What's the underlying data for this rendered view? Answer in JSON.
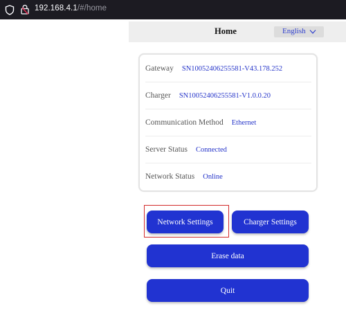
{
  "browser": {
    "url_host": "192.168.4.1",
    "url_path": "/#/home"
  },
  "header": {
    "title": "Home",
    "language": "English"
  },
  "info": {
    "gateway_label": "Gateway",
    "gateway_value": "SN10052406255581-V43.178.252",
    "charger_label": "Charger",
    "charger_value": "SN10052406255581-V1.0.0.20",
    "comm_label": "Communication Method",
    "comm_value": "Ethernet",
    "server_label": "Server Status",
    "server_value": "Connected",
    "network_label": "Network Status",
    "network_value": "Online"
  },
  "buttons": {
    "network_settings": "Network Settings",
    "charger_settings": "Charger Settings",
    "erase_data": "Erase data",
    "quit": "Quit"
  },
  "colors": {
    "primary": "#2133d1",
    "value_text": "#2534c9",
    "highlight": "#d22a2a"
  }
}
